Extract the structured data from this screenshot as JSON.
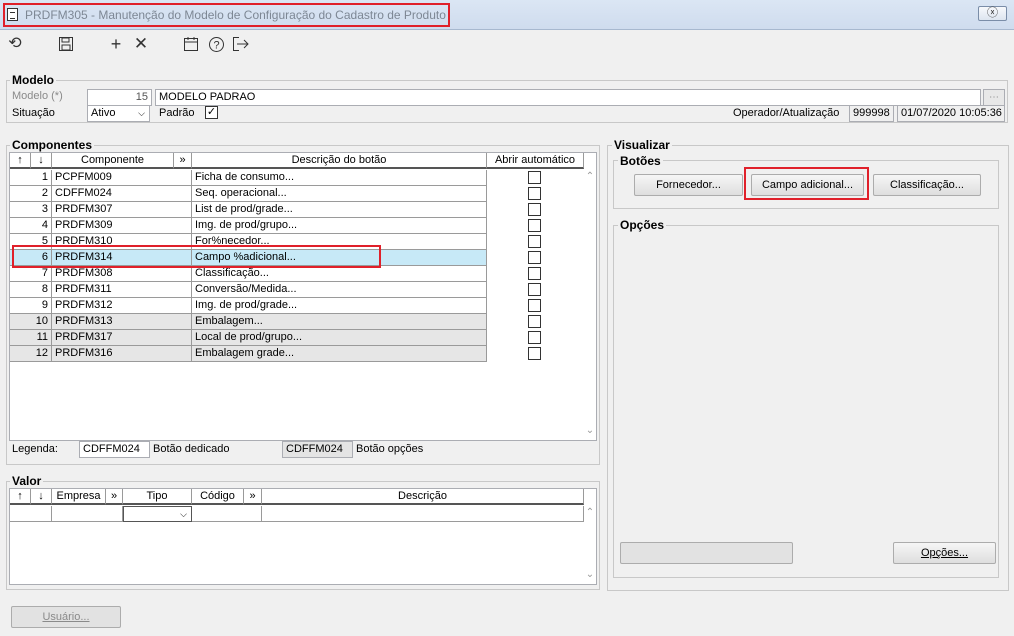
{
  "window": {
    "title": "PRDFM305 - Manutenção do Modelo de Configuração do Cadastro de Produto",
    "close": "ⓧ"
  },
  "toolbar": {
    "icons": [
      "refresh-icon",
      "save-icon",
      "add-icon",
      "delete-icon",
      "calendar-icon",
      "help-icon",
      "exit-icon"
    ]
  },
  "modelo": {
    "title": "Modelo",
    "modelo_label": "Modelo (*)",
    "modelo_num": "15",
    "modelo_name": "MODELO PADRAO",
    "situacao_label": "Situação",
    "situacao_value": "Ativo",
    "padrao_label": "Padrão",
    "operador_label": "Operador/Atualização",
    "operador_value": "999998",
    "data_value": "01/07/2020 10:05:36"
  },
  "componentes": {
    "title": "Componentes",
    "headers": {
      "up": "↑",
      "down": "↓",
      "componente": "Componente",
      "more": "»",
      "descricao": "Descrição do botão",
      "abrir": "Abrir automático"
    },
    "rows": [
      {
        "n": "1",
        "comp": "PCPFM009",
        "desc": "Ficha de consumo..."
      },
      {
        "n": "2",
        "comp": "CDFFM024",
        "desc": "Seq. operacional..."
      },
      {
        "n": "3",
        "comp": "PRDFM307",
        "desc": "List de prod/grade..."
      },
      {
        "n": "4",
        "comp": "PRDFM309",
        "desc": "Img. de prod/grupo..."
      },
      {
        "n": "5",
        "comp": "PRDFM310",
        "desc": "For%necedor..."
      },
      {
        "n": "6",
        "comp": "PRDFM314",
        "desc": "Campo %adicional..."
      },
      {
        "n": "7",
        "comp": "PRDFM308",
        "desc": "Classificação..."
      },
      {
        "n": "8",
        "comp": "PRDFM311",
        "desc": "Conversão/Medida..."
      },
      {
        "n": "9",
        "comp": "PRDFM312",
        "desc": "Img. de prod/grade..."
      },
      {
        "n": "10",
        "comp": "PRDFM313",
        "desc": "Embalagem..."
      },
      {
        "n": "11",
        "comp": "PRDFM317",
        "desc": "Local de prod/grupo..."
      },
      {
        "n": "12",
        "comp": "PRDFM316",
        "desc": "Embalagem grade..."
      }
    ],
    "legenda_label": "Legenda:",
    "legenda1": "CDFFM024",
    "legenda1_text": "Botão dedicado",
    "legenda2": "CDFFM024",
    "legenda2_text": "Botão opções"
  },
  "valor": {
    "title": "Valor",
    "headers": {
      "up": "↑",
      "down": "↓",
      "empresa": "Empresa",
      "more1": "»",
      "tipo": "Tipo",
      "codigo": "Código",
      "more2": "»",
      "descricao": "Descrição"
    }
  },
  "visualizar": {
    "title": "Visualizar",
    "botoes_title": "Botões",
    "btn1": "Fornecedor...",
    "btn2": "Campo adicional...",
    "btn3": "Classificação...",
    "opcoes_title": "Opções",
    "opcoes_btn": "Opções..."
  },
  "footer": {
    "usuario": "Usuário..."
  },
  "colors": {
    "highlight": "#e0202a",
    "selected_row": "#c7e9f7"
  }
}
